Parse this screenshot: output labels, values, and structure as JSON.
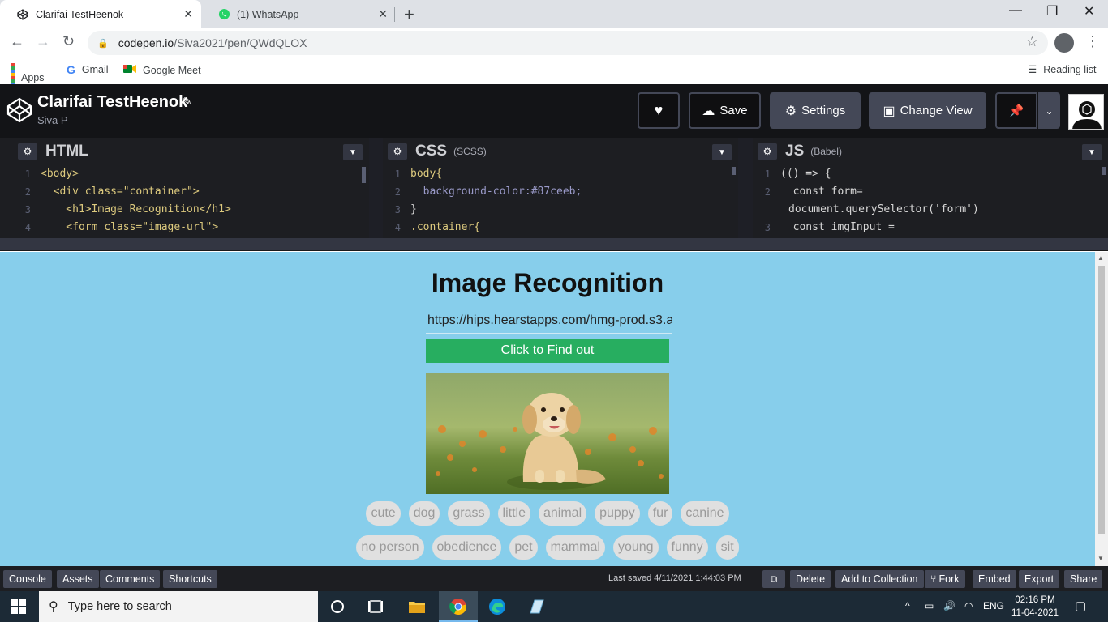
{
  "browser": {
    "tabs": [
      {
        "title": "Clarifai TestHeenok",
        "active": true
      },
      {
        "title": "(1) WhatsApp",
        "active": false
      }
    ],
    "url_host": "codepen.io",
    "url_path": "/Siva2021/pen/QWdQLOX",
    "bookmarks": [
      "Apps",
      "Gmail",
      "Google Meet"
    ],
    "reading_list": "Reading list"
  },
  "header": {
    "title": "Clarifai TestHeenok",
    "user": "Siva P",
    "save": "Save",
    "settings": "Settings",
    "change_view": "Change View"
  },
  "editors": {
    "html": {
      "title": "HTML",
      "lines": [
        {
          "n": "1",
          "text": "<body>"
        },
        {
          "n": "2",
          "text": "  <div class=\"container\">"
        },
        {
          "n": "3",
          "text": "    <h1>Image Recognition</h1>"
        },
        {
          "n": "4",
          "text": "    <form class=\"image-url\">"
        }
      ]
    },
    "css": {
      "title": "CSS",
      "sub": "(SCSS)",
      "lines": [
        {
          "n": "1",
          "text": "body{"
        },
        {
          "n": "2",
          "text": "  background-color:#87ceeb;"
        },
        {
          "n": "3",
          "text": "}"
        },
        {
          "n": "4",
          "text": ".container{"
        }
      ]
    },
    "js": {
      "title": "JS",
      "sub": "(Babel)",
      "lines": [
        {
          "n": "1",
          "text": "(() => {"
        },
        {
          "n": "2",
          "text": "  const form="
        },
        {
          "n": "",
          "text": "document.querySelector('form')"
        },
        {
          "n": "3",
          "text": "  const imgInput ="
        }
      ]
    }
  },
  "preview": {
    "title": "Image Recognition",
    "input_value": "https://hips.hearstapps.com/hmg-prod.s3.a",
    "button": "Click to Find out",
    "tags_row1": [
      "cute",
      "dog",
      "grass",
      "little",
      "animal",
      "puppy",
      "fur",
      "canine"
    ],
    "tags_row2": [
      "no person",
      "obedience",
      "pet",
      "mammal",
      "young",
      "funny",
      "sit"
    ]
  },
  "footer": {
    "left": [
      "Console",
      "Assets",
      "Comments",
      "Shortcuts"
    ],
    "last_saved": "Last saved 4/11/2021 1:44:03 PM",
    "right": [
      "Delete",
      "Add to Collection",
      "Fork",
      "Embed",
      "Export",
      "Share"
    ]
  },
  "taskbar": {
    "search_placeholder": "Type here to search",
    "lang": "ENG",
    "time": "02:16 PM",
    "date": "11-04-2021"
  }
}
